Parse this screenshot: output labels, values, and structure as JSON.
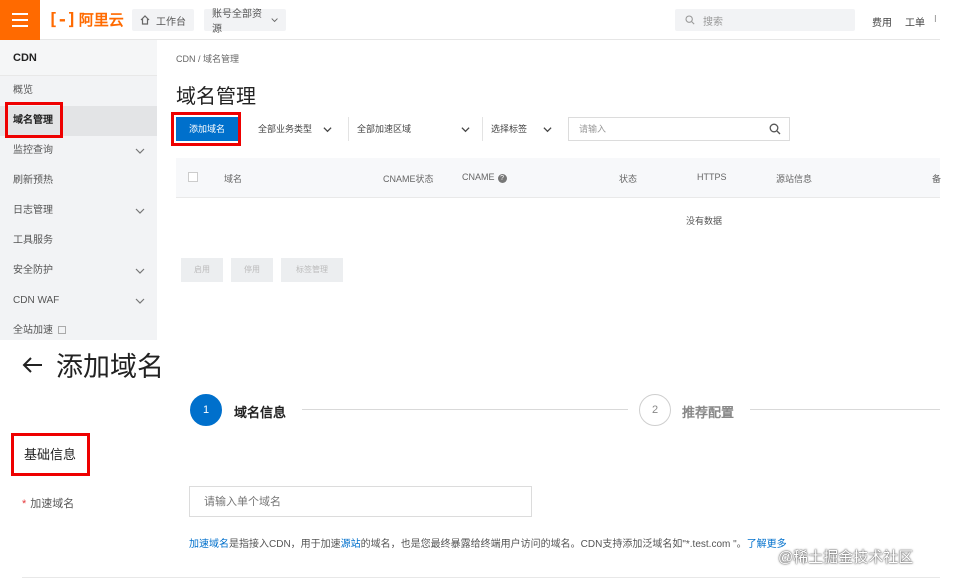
{
  "topbar": {
    "logo_text": "阿里云",
    "workbench": "工作台",
    "resource_group": "账号全部资源",
    "search_placeholder": "搜索",
    "cost": "费用",
    "ticket": "工单",
    "more": "I"
  },
  "sidebar": {
    "title": "CDN",
    "items": [
      {
        "label": "概览"
      },
      {
        "label": "域名管理"
      },
      {
        "label": "监控查询"
      },
      {
        "label": "刷新预热"
      },
      {
        "label": "日志管理"
      },
      {
        "label": "工具服务"
      },
      {
        "label": "安全防护"
      },
      {
        "label": "CDN WAF"
      },
      {
        "label": "全站加速"
      }
    ]
  },
  "console": {
    "breadcrumb": "CDN  /  域名管理",
    "title": "域名管理",
    "add_button": "添加域名",
    "filter_business": "全部业务类型",
    "filter_region": "全部加速区域",
    "filter_tag": "选择标签",
    "search_placeholder": "请输入",
    "columns": [
      "域名",
      "CNAME状态",
      "CNAME",
      "状态",
      "HTTPS",
      "源站信息",
      "备"
    ],
    "empty_text": "没有数据",
    "bulk_actions": [
      "启用",
      "停用",
      "标签管理"
    ]
  },
  "add_domain": {
    "title": "添加域名",
    "steps": [
      {
        "number": "1",
        "label": "域名信息"
      },
      {
        "number": "2",
        "label": "推荐配置"
      }
    ],
    "section_title": "基础信息",
    "field_required_mark": "*",
    "field_label": "加速域名",
    "field_placeholder": "请输入单个域名",
    "help_link_1": "加速域名",
    "help_text_1": "是指接入CDN，用于加速",
    "help_link_2": "源站",
    "help_text_2": "的域名，也是您最终暴露给终端用户访问的域名。CDN支持添加泛域名如\"*.test.com \"。",
    "help_link_3": "了解更多"
  },
  "watermark": "@稀土掘金技术社区",
  "colors": {
    "brand_orange": "#ff6a00",
    "primary_blue": "#0070cc",
    "annotation_red": "#e00000"
  }
}
